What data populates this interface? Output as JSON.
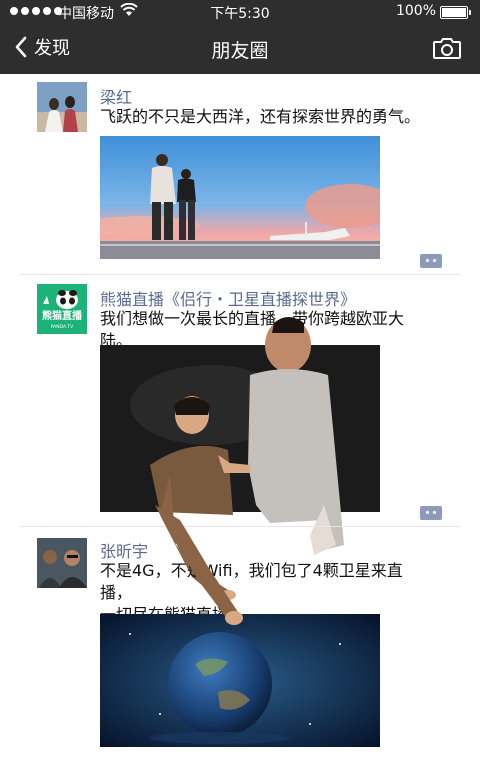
{
  "status_bar": {
    "carrier": "中国移动",
    "time": "下午5:30",
    "battery": "100%"
  },
  "nav": {
    "back_label": "发现",
    "title": "朋友圈"
  },
  "posts": [
    {
      "name": "梁红",
      "text": "飞跃的不只是大西洋，还有探索世界的勇气。"
    },
    {
      "name": "熊猫直播《侣行・卫星直播探世界》",
      "text": "我们想做一次最长的直播，带你跨越欧亚大陆。",
      "avatar_text": "熊猫直播",
      "avatar_sub": "PANDA.TV"
    },
    {
      "name": "张昕宇",
      "text_line1": "不是4G，不是Wifi，我们包了4颗卫星来直播，",
      "text_line2": "一切尽在熊猫直播"
    }
  ]
}
